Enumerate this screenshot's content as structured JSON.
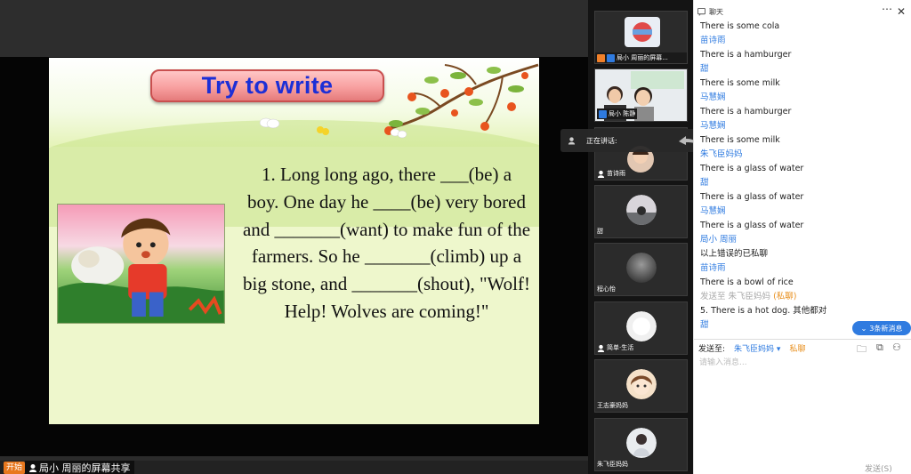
{
  "slide": {
    "title": "Try to write",
    "exercise_lines": [
      "1.  Long long ago, there ___(be) a",
      "boy. One day he ____(be) very bored",
      "and _______(want) to make fun of the",
      "farmers. So he _______(climb) up a",
      "big stone, and _______(shout), \"Wolf!",
      "Help! Wolves are coming!\""
    ]
  },
  "share_footer": {
    "start_label": "开始",
    "share_label": "局小 周丽的屏幕共享"
  },
  "speaking": {
    "label": "正在讲话:"
  },
  "participants": [
    {
      "name": "局小 周丽的屏幕..."
    },
    {
      "name": "局小 陈静"
    },
    {
      "name": "苗诗雨"
    },
    {
      "name": "甜"
    },
    {
      "name": "程心怡"
    },
    {
      "name": "简单·生活"
    },
    {
      "name": "王志豪妈妈"
    },
    {
      "name": "朱飞臣妈妈"
    }
  ],
  "chat": {
    "title": "聊天",
    "messages": [
      {
        "kind": "text",
        "text": "There is some cola"
      },
      {
        "kind": "sender",
        "text": "苗诗雨"
      },
      {
        "kind": "text",
        "text": "There is a  hamburger"
      },
      {
        "kind": "sender",
        "text": "甜"
      },
      {
        "kind": "text",
        "text": "There is some milk"
      },
      {
        "kind": "sender",
        "text": "马慧娴"
      },
      {
        "kind": "text",
        "text": "There is a  hamburger"
      },
      {
        "kind": "sender",
        "text": "马慧娴"
      },
      {
        "kind": "text",
        "text": "There is some milk"
      },
      {
        "kind": "sender",
        "text": "朱飞臣妈妈"
      },
      {
        "kind": "text",
        "text": "There is  a glass of water"
      },
      {
        "kind": "sender",
        "text": "甜"
      },
      {
        "kind": "text",
        "text": "There is a glass of water"
      },
      {
        "kind": "sender",
        "text": "马慧娴"
      },
      {
        "kind": "text",
        "text": "There is a glass of water"
      },
      {
        "kind": "sender",
        "text": "局小 周丽"
      },
      {
        "kind": "text",
        "text": "以上错误的已私聊"
      },
      {
        "kind": "sender",
        "text": "苗诗雨"
      },
      {
        "kind": "text",
        "text": "There is  a bowl of rice"
      },
      {
        "kind": "private",
        "prefix": "发送至",
        "target": "朱飞臣妈妈",
        "tag": "(私聊)"
      },
      {
        "kind": "text",
        "text": "5. There is  a hot dog. 其他都对"
      },
      {
        "kind": "sender",
        "text": "甜"
      }
    ],
    "new_messages": "3条新消息",
    "send_to_label": "发送至:",
    "send_to_target": "朱飞臣妈妈",
    "private_label": "私聊",
    "input_placeholder": "请输入消息...",
    "send_button": "发送(S)"
  },
  "colors": {
    "accent": "#2f7be0",
    "private": "#e8901f",
    "title": "#1c2fd6"
  }
}
